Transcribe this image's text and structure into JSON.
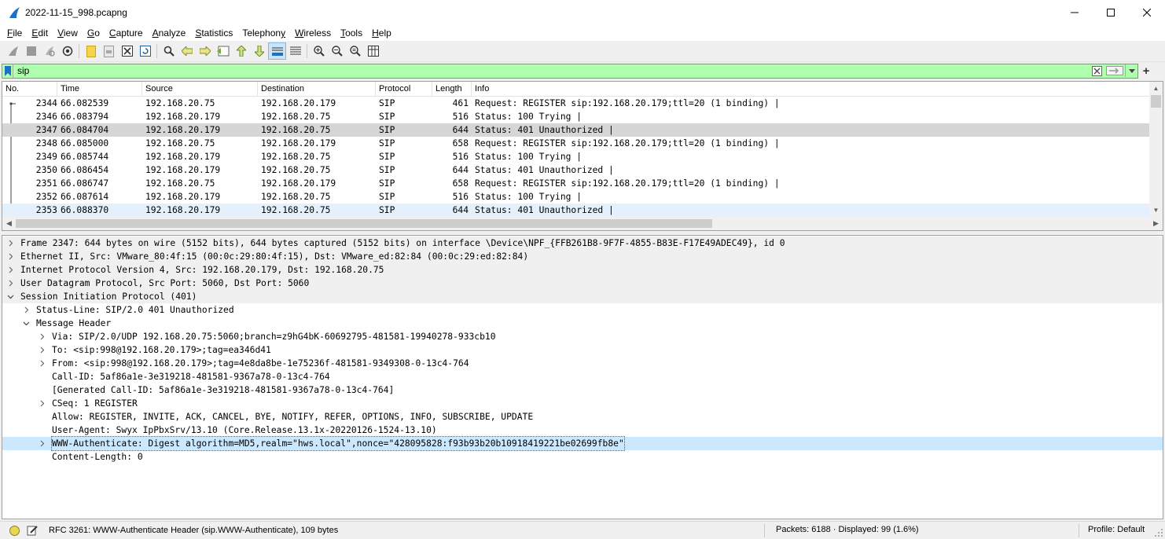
{
  "window": {
    "title": "2022-11-15_998.pcapng",
    "minimize_glyph": "—",
    "maximize_glyph": "☐",
    "close_glyph": "✕",
    "icon": "wireshark-fin-icon"
  },
  "menu": [
    {
      "mnemonic": "F",
      "rest": "ile"
    },
    {
      "mnemonic": "E",
      "rest": "dit"
    },
    {
      "mnemonic": "V",
      "rest": "iew"
    },
    {
      "mnemonic": "G",
      "rest": "o"
    },
    {
      "mnemonic": "C",
      "rest": "apture"
    },
    {
      "mnemonic": "A",
      "rest": "nalyze"
    },
    {
      "mnemonic": "S",
      "rest": "tatistics"
    },
    {
      "mnemonic": "y",
      "pre": "Telephon",
      "rest": ""
    },
    {
      "mnemonic": "W",
      "rest": "ireless"
    },
    {
      "mnemonic": "T",
      "rest": "ools"
    },
    {
      "mnemonic": "H",
      "rest": "elp"
    }
  ],
  "filter": {
    "value": "sip",
    "plus": "+"
  },
  "packet_list": {
    "columns": [
      "No.",
      "Time",
      "Source",
      "Destination",
      "Protocol",
      "Length",
      "Info"
    ],
    "rows": [
      {
        "no": "2344",
        "time": "66.082539",
        "src": "192.168.20.75",
        "dst": "192.168.20.179",
        "proto": "SIP",
        "len": "461",
        "info": "Request: REGISTER sip:192.168.20.179;ttl=20  (1 binding) |"
      },
      {
        "no": "2346",
        "time": "66.083794",
        "src": "192.168.20.179",
        "dst": "192.168.20.75",
        "proto": "SIP",
        "len": "516",
        "info": "Status: 100 Trying |"
      },
      {
        "no": "2347",
        "time": "66.084704",
        "src": "192.168.20.179",
        "dst": "192.168.20.75",
        "proto": "SIP",
        "len": "644",
        "info": "Status: 401 Unauthorized |"
      },
      {
        "no": "2348",
        "time": "66.085000",
        "src": "192.168.20.75",
        "dst": "192.168.20.179",
        "proto": "SIP",
        "len": "658",
        "info": "Request: REGISTER sip:192.168.20.179;ttl=20  (1 binding) |"
      },
      {
        "no": "2349",
        "time": "66.085744",
        "src": "192.168.20.179",
        "dst": "192.168.20.75",
        "proto": "SIP",
        "len": "516",
        "info": "Status: 100 Trying |"
      },
      {
        "no": "2350",
        "time": "66.086454",
        "src": "192.168.20.179",
        "dst": "192.168.20.75",
        "proto": "SIP",
        "len": "644",
        "info": "Status: 401 Unauthorized |"
      },
      {
        "no": "2351",
        "time": "66.086747",
        "src": "192.168.20.75",
        "dst": "192.168.20.179",
        "proto": "SIP",
        "len": "658",
        "info": "Request: REGISTER sip:192.168.20.179;ttl=20  (1 binding) |"
      },
      {
        "no": "2352",
        "time": "66.087614",
        "src": "192.168.20.179",
        "dst": "192.168.20.75",
        "proto": "SIP",
        "len": "516",
        "info": "Status: 100 Trying |"
      },
      {
        "no": "2353",
        "time": "66.088370",
        "src": "192.168.20.179",
        "dst": "192.168.20.75",
        "proto": "SIP",
        "len": "644",
        "info": "Status: 401 Unauthorized |"
      }
    ]
  },
  "details": [
    {
      "text": "Frame 2347: 644 bytes on wire (5152 bits), 644 bytes captured (5152 bits) on interface \\Device\\NPF_{FFB261B8-9F7F-4855-B83E-F17E49ADEC49}, id 0",
      "level": 0,
      "exp": "closed"
    },
    {
      "text": "Ethernet II, Src: VMware_80:4f:15 (00:0c:29:80:4f:15), Dst: VMware_ed:82:84 (00:0c:29:ed:82:84)",
      "level": 0,
      "exp": "closed"
    },
    {
      "text": "Internet Protocol Version 4, Src: 192.168.20.179, Dst: 192.168.20.75",
      "level": 0,
      "exp": "closed"
    },
    {
      "text": "User Datagram Protocol, Src Port: 5060, Dst Port: 5060",
      "level": 0,
      "exp": "closed"
    },
    {
      "text": "Session Initiation Protocol (401)",
      "level": 0,
      "exp": "open"
    },
    {
      "text": "Status-Line: SIP/2.0 401 Unauthorized",
      "level": 1,
      "exp": "closed"
    },
    {
      "text": "Message Header",
      "level": 1,
      "exp": "open"
    },
    {
      "text": "Via: SIP/2.0/UDP 192.168.20.75:5060;branch=z9hG4bK-60692795-481581-19940278-933cb10",
      "level": 2,
      "exp": "closed"
    },
    {
      "text": "To: <sip:998@192.168.20.179>;tag=ea346d41",
      "level": 2,
      "exp": "closed"
    },
    {
      "text": "From: <sip:998@192.168.20.179>;tag=4e8da8be-1e75236f-481581-9349308-0-13c4-764",
      "level": 2,
      "exp": "closed"
    },
    {
      "text": "Call-ID: 5af86a1e-3e319218-481581-9367a78-0-13c4-764",
      "level": 2,
      "exp": "none"
    },
    {
      "text": "[Generated Call-ID: 5af86a1e-3e319218-481581-9367a78-0-13c4-764]",
      "level": 2,
      "exp": "none"
    },
    {
      "text": "CSeq: 1 REGISTER",
      "level": 2,
      "exp": "closed"
    },
    {
      "text": "Allow: REGISTER, INVITE, ACK, CANCEL, BYE, NOTIFY, REFER, OPTIONS, INFO, SUBSCRIBE, UPDATE",
      "level": 2,
      "exp": "none"
    },
    {
      "text": "User-Agent: Swyx IpPbxSrv/13.10 (Core.Release.13.1x-20220126-1524-13.10)",
      "level": 2,
      "exp": "none"
    },
    {
      "text": "WWW-Authenticate: Digest algorithm=MD5,realm=\"hws.local\",nonce=\"428095828:f93b93b20b10918419221be02699fb8e\"",
      "level": 2,
      "exp": "closed"
    },
    {
      "text": "Content-Length: 0",
      "level": 2,
      "exp": "none"
    }
  ],
  "status": {
    "field_info": "RFC 3261: WWW-Authenticate Header (sip.WWW-Authenticate), 109 bytes",
    "packets": "Packets: 6188 · Displayed: 99 (1.6%)",
    "profile": "Profile: Default"
  },
  "colors": {
    "filter_valid": "#afffaf",
    "selected_packet": "#d6d6d6",
    "selected_field": "#cce8ff"
  }
}
